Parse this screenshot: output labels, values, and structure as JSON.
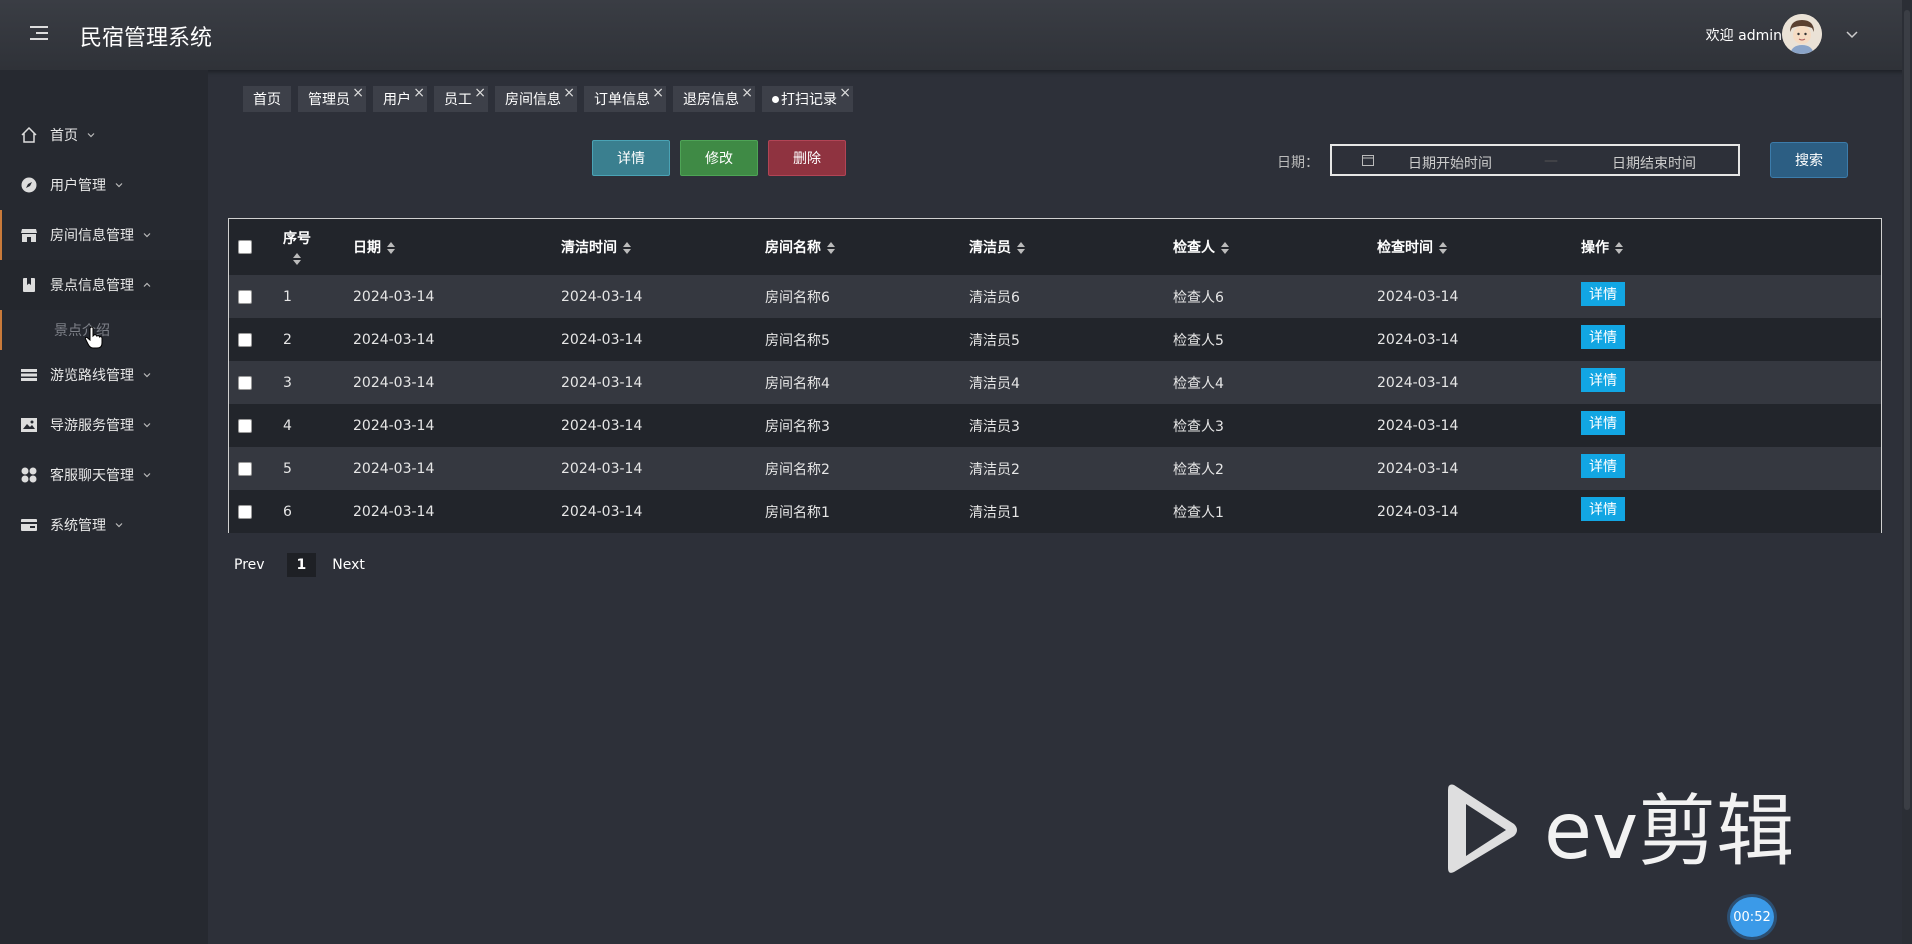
{
  "header": {
    "app_title": "民宿管理系统",
    "welcome": "欢迎 admin"
  },
  "sidebar": {
    "items": [
      {
        "label": "首页",
        "icon": "home-icon"
      },
      {
        "label": "用户管理",
        "icon": "compass-icon"
      },
      {
        "label": "房间信息管理",
        "icon": "store-icon"
      },
      {
        "label": "景点信息管理",
        "icon": "bookmark-icon"
      },
      {
        "label": "游览路线管理",
        "icon": "list-icon"
      },
      {
        "label": "导游服务管理",
        "icon": "image-icon"
      },
      {
        "label": "客服聊天管理",
        "icon": "grid-icon"
      },
      {
        "label": "系统管理",
        "icon": "card-icon"
      }
    ],
    "sub_item": "景点介绍"
  },
  "tabs": [
    {
      "label": "首页"
    },
    {
      "label": "管理员"
    },
    {
      "label": "用户"
    },
    {
      "label": "员工"
    },
    {
      "label": "房间信息"
    },
    {
      "label": "订单信息"
    },
    {
      "label": "退房信息"
    },
    {
      "label": "打扫记录"
    }
  ],
  "toolbar": {
    "detail_label": "详情",
    "edit_label": "修改",
    "delete_label": "删除"
  },
  "search": {
    "date_label": "日期：",
    "start_placeholder": "日期开始时间",
    "end_placeholder": "日期结束时间",
    "separator": "—",
    "search_label": "搜索"
  },
  "table": {
    "columns": [
      "序号",
      "日期",
      "清洁时间",
      "房间名称",
      "清洁员",
      "检查人",
      "检查时间",
      "操作"
    ],
    "rows": [
      {
        "seq": "1",
        "date": "2024-03-14",
        "clean_time": "2024-03-14",
        "room": "房间名称6",
        "cleaner": "清洁员6",
        "inspector": "检查人6",
        "check_time": "2024-03-14",
        "action": "详情"
      },
      {
        "seq": "2",
        "date": "2024-03-14",
        "clean_time": "2024-03-14",
        "room": "房间名称5",
        "cleaner": "清洁员5",
        "inspector": "检查人5",
        "check_time": "2024-03-14",
        "action": "详情"
      },
      {
        "seq": "3",
        "date": "2024-03-14",
        "clean_time": "2024-03-14",
        "room": "房间名称4",
        "cleaner": "清洁员4",
        "inspector": "检查人4",
        "check_time": "2024-03-14",
        "action": "详情"
      },
      {
        "seq": "4",
        "date": "2024-03-14",
        "clean_time": "2024-03-14",
        "room": "房间名称3",
        "cleaner": "清洁员3",
        "inspector": "检查人3",
        "check_time": "2024-03-14",
        "action": "详情"
      },
      {
        "seq": "5",
        "date": "2024-03-14",
        "clean_time": "2024-03-14",
        "room": "房间名称2",
        "cleaner": "清洁员2",
        "inspector": "检查人2",
        "check_time": "2024-03-14",
        "action": "详情"
      },
      {
        "seq": "6",
        "date": "2024-03-14",
        "clean_time": "2024-03-14",
        "room": "房间名称1",
        "cleaner": "清洁员1",
        "inspector": "检查人1",
        "check_time": "2024-03-14",
        "action": "详情"
      }
    ]
  },
  "pager": {
    "prev": "Prev",
    "page": "1",
    "next": "Next"
  },
  "watermark": {
    "text": "ev剪辑"
  },
  "timer": "00:52",
  "colors": {
    "background": "#2d3039",
    "sidebar": "#262930",
    "detail_button": "#12a6e3",
    "edit_button": "#3f8a45",
    "delete_button": "#8f3340",
    "search_button": "#2c5e83",
    "accent": "#c97a3a"
  }
}
